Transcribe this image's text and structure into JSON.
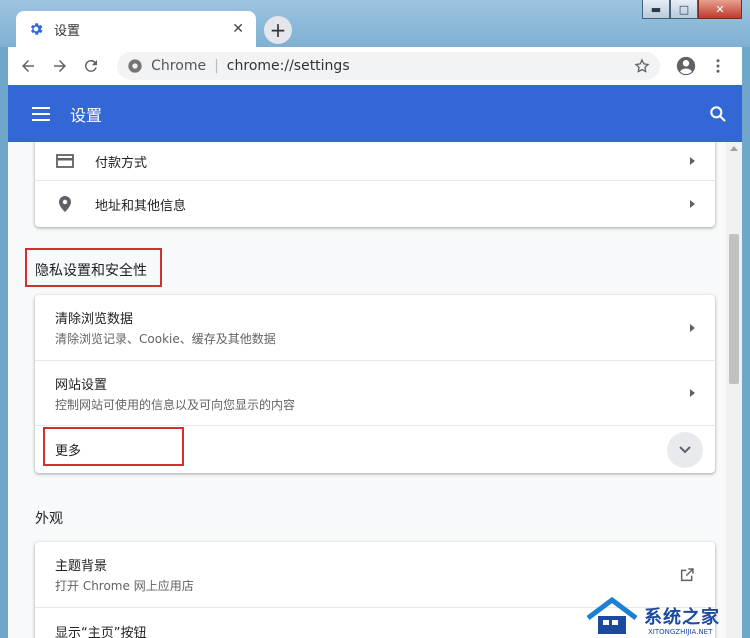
{
  "tab": {
    "title": "设置",
    "close": "✕",
    "new_tab": "+"
  },
  "window_controls": {
    "minimize": "▬",
    "maximize": "□",
    "close": "✕"
  },
  "toolbar": {
    "site_name": "Chrome",
    "url": "chrome://settings"
  },
  "header": {
    "title": "设置"
  },
  "autofill": {
    "items": [
      {
        "label": "付款方式",
        "icon": "credit-card-icon"
      },
      {
        "label": "地址和其他信息",
        "icon": "location-pin-icon"
      }
    ]
  },
  "privacy": {
    "title": "隐私设置和安全性",
    "items": [
      {
        "label": "清除浏览数据",
        "sub": "清除浏览记录、Cookie、缓存及其他数据"
      },
      {
        "label": "网站设置",
        "sub": "控制网站可使用的信息以及可向您显示的内容"
      }
    ],
    "more": "更多"
  },
  "appearance": {
    "title": "外观",
    "items": [
      {
        "label": "主题背景",
        "sub": "打开 Chrome 网上应用店"
      },
      {
        "label": "显示“主页”按钮"
      }
    ]
  },
  "watermark": {
    "text": "系统之家",
    "sub": "XITONGZHIJIA.NET"
  },
  "colors": {
    "accent": "#3367d6",
    "highlight_box": "#d03030"
  }
}
